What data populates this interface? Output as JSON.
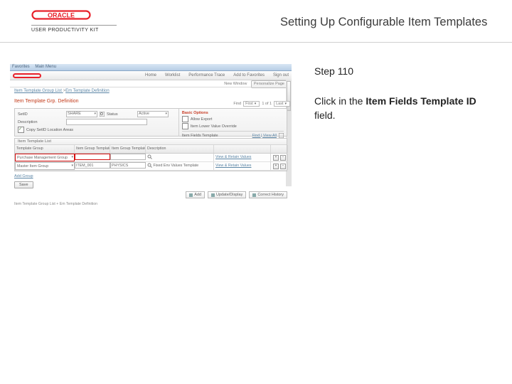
{
  "header": {
    "upk_label": "USER PRODUCTIVITY KIT",
    "title": "Setting Up Configurable Item Templates"
  },
  "right": {
    "step": "Step 110",
    "instr_pre": "Click in the ",
    "instr_bold": "Item Fields Template ID",
    "instr_post": " field."
  },
  "mini": {
    "bluebar_items": [
      "Favorites",
      "Main Menu"
    ],
    "nav_items": [
      "Home",
      "Worklist",
      "Performance Trace",
      "Add to Favorites",
      "Sign out"
    ],
    "new_window": "New Window",
    "personalize": "Personalize Page",
    "breadcrumb": [
      "Item Template Group List",
      "Em Template Definition"
    ],
    "section1": "Item Template Grp. Definition",
    "find_top": {
      "find": "Find",
      "first": "First",
      "range": "1 of 1",
      "last": "Last"
    },
    "left_rows": {
      "setid": {
        "label": "SetID",
        "value": "SHARE"
      },
      "status": {
        "label": "Status",
        "value": "Active"
      },
      "desc": {
        "label": "Description",
        "value": ""
      },
      "copy": {
        "label": "Copy SetID Location Areas"
      }
    },
    "right_rows": {
      "basic": "Basic Options",
      "allow": "Allow Export",
      "lower": "Item Lower Value Override",
      "subhead": "Item Fields Template",
      "find2": "Find | View All"
    },
    "tlist_title": "Item Template List",
    "thead": [
      "Template Group",
      "Item Group Template ID",
      "Item Group Template ID",
      "Description",
      "",
      ""
    ],
    "trow1": {
      "group": "Purchase Management Group",
      "desc_link": "View & Retain Values"
    },
    "trow2": {
      "group": "Master Item Group",
      "t1": "ITEM_001",
      "t2": "PHYSICS",
      "desc": "Fixed Env Values Template",
      "desc_link": "View & Retain Values"
    },
    "addl": "Add Group",
    "save": "Save",
    "footer_actions": [
      "Add",
      "Update/Display",
      "Correct History"
    ],
    "caption": "Item Template Group List + Em Template Definition"
  }
}
